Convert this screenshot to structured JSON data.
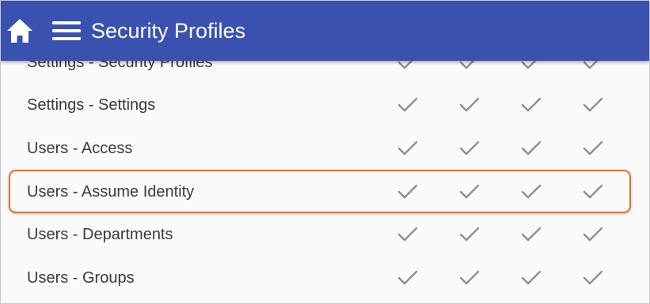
{
  "header": {
    "title": "Security Profiles",
    "home_icon": "home-icon",
    "menu_icon": "hamburger-menu-icon",
    "background": "#3a51b0"
  },
  "rows": [
    {
      "label": "Settings - Security Profiles",
      "checks": [
        true,
        true,
        true,
        true
      ]
    },
    {
      "label": "Settings - Settings",
      "checks": [
        true,
        true,
        true,
        true
      ]
    },
    {
      "label": "Users - Access",
      "checks": [
        true,
        true,
        true,
        true
      ]
    },
    {
      "label": "Users - Assume Identity",
      "checks": [
        true,
        true,
        true,
        true
      ],
      "highlighted": true
    },
    {
      "label": "Users - Departments",
      "checks": [
        true,
        true,
        true,
        true
      ]
    },
    {
      "label": "Users - Groups",
      "checks": [
        true,
        true,
        true,
        true
      ]
    }
  ],
  "check_icon": "checkmark-icon",
  "highlight_color": "#ec6b2d"
}
